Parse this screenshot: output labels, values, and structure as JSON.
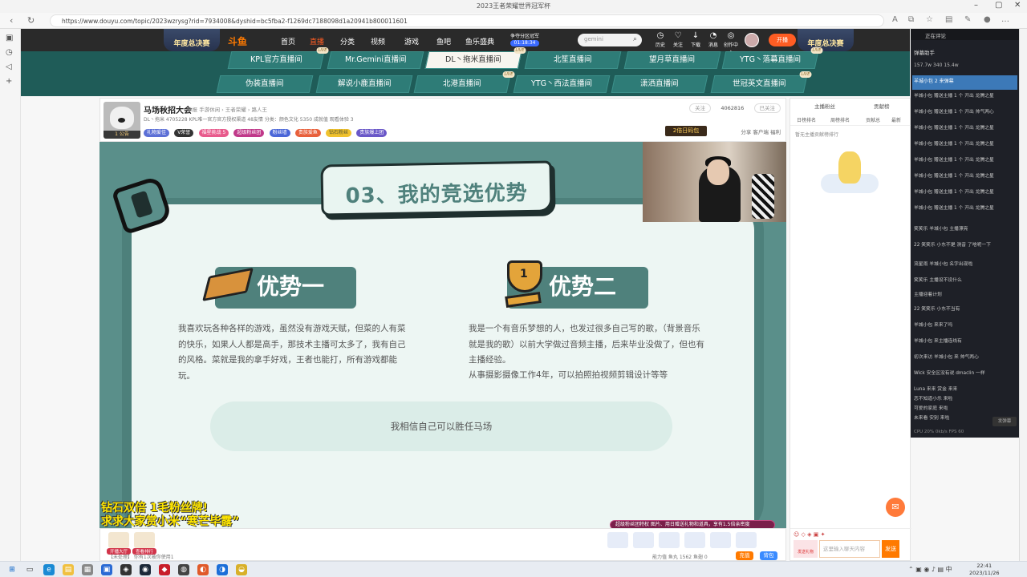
{
  "browser": {
    "tab_title": "2023王者荣耀世界冠军杯",
    "url": "https://www.douyu.com/topic/2023wzrysg?rid=7934008&dyshid=bc5fba2-f1269dc7188098d1a20941b800011601"
  },
  "header": {
    "banner_left": "年度总决赛",
    "banner_right": "年度总决赛",
    "logo": "斗鱼",
    "nav": [
      "首页",
      "直播",
      "分类",
      "视频",
      "游戏",
      "鱼吧",
      "鱼乐盛典"
    ],
    "active_nav": "直播",
    "time_label": "争夺分区冠军",
    "time_value": "01:18:34",
    "search_placeholder": "gemini",
    "icons": [
      {
        "name": "history-icon",
        "label": "历史"
      },
      {
        "name": "follow-icon",
        "label": "关注"
      },
      {
        "name": "download-icon",
        "label": "下载"
      },
      {
        "name": "notice-icon",
        "label": "消息"
      },
      {
        "name": "center-icon",
        "label": "创作中心"
      }
    ],
    "live_button": "开播"
  },
  "rec_rooms": [
    {
      "label": "KPL官方直播间",
      "live": true
    },
    {
      "label": "Mr.Gemini直播间",
      "live": false
    },
    {
      "label": "DL丶拖米直播间",
      "live": true,
      "selected": true
    },
    {
      "label": "北笙直播间",
      "live": false
    },
    {
      "label": "望月草直播间",
      "live": false
    },
    {
      "label": "YTG丶落幕直播间",
      "live": true
    },
    {
      "label": "伪装直播间",
      "live": false
    },
    {
      "label": "解说小鹿直播间",
      "live": false
    },
    {
      "label": "北港直播间",
      "live": true
    },
    {
      "label": "YTG丶西法直播间",
      "live": false
    },
    {
      "label": "潇洒直播间",
      "live": false
    },
    {
      "label": "世冠英文直播间",
      "live": true
    }
  ],
  "streamer": {
    "name": "马场秋招大会",
    "meta": "举报  手游休闲 › 王者荣耀 › 路人王",
    "level": "1 公告",
    "stat_row": "DL丶拖米  4705228   KPL唯一官方官方授权渠道   48友情   分类：颜色文化   5350 成就值   观看体验 3",
    "badges": [
      "礼物爱佳",
      "V荣誉",
      "福星挑战 5",
      "超级粉丝团",
      "粉丝墙",
      "无上榜",
      "贵族爱鱼",
      "钻石粉丝",
      "贵族爆上团"
    ],
    "follow_count": "4062816",
    "follow_btn": "已关注",
    "report_btn": "关注",
    "actions": "分享   客户端   福利",
    "activity_badge": "2倍日码包"
  },
  "slide": {
    "title": "03、我的竞选优势",
    "adv1_title": "优势一",
    "adv2_title": "优势二",
    "adv1_text": "我喜欢玩各种各样的游戏，虽然没有游戏天赋，但菜的人有菜的快乐，如果人人都是高手，那技术主播可太多了，我有自己的风格。菜就是我的拿手好戏，王者也能打，所有游戏都能玩。",
    "adv2_text_1": "我是一个有音乐梦想的人，也发过很多自己写的歌，（背景音乐就是我的歌）以前大学做过音频主播，后来毕业没做了，但也有主播经验。",
    "adv2_text_2": "从事摄影摄像工作4年，可以拍照拍视频剪辑设计等等",
    "belief": "我相信自己可以胜任马场",
    "promo_line1": "钻石双倍 1毛粉丝牌!",
    "promo_line2": "求求大家赏小米“寒芒毕露”",
    "gift_banner": "超级粉丝团特权  图片、用日赠送礼物和道具，享有1.5倍亲密度"
  },
  "playerbar": {
    "gifts": [
      "开播大厅",
      "查看排行"
    ],
    "note": "【未处理】 你有1次被你使用1",
    "mid": "能力值  鱼丸 1562  鱼翅 0",
    "btn1": "充值",
    "btn2": "背包"
  },
  "rank_panel": {
    "tab1": "主播粉丝",
    "tab2": "贡献榜",
    "subtabs": [
      "日榜排名",
      "周榜排名",
      "贡献总",
      "最新"
    ],
    "hint": "暂无主播贡献榜排行",
    "input_placeholder": "这里输入聊天内容",
    "send": "发送",
    "gift_label": "发送礼物"
  },
  "chat_overlay": {
    "top_label": "正在评论",
    "head": "弹幕助手",
    "stats": "157.7w   340   15.4w",
    "highlight": "羊城小包  2  来弹幕",
    "lines": [
      "羊城小包 赠送主播 1 个 开出 龙腾之星",
      "羊城小包 赠送主播 1 个 开出 帅气两心",
      "羊城小包 赠送主播 1 个 开出 龙腾之星",
      "羊城小包 赠送主播 1 个 开出 龙腾之星",
      "羊城小包 赠送主播 1 个 开出 龙腾之星",
      "羊城小包 赠送主播 1 个 开出 龙腾之星",
      "羊城小包 赠送主播 1 个 开出 龙腾之星",
      "羊城小包 赠送主播 1 个 开出 龙腾之星",
      "笑笑乐 羊城小包 主播漂亮",
      "22 笑笑乐 小东不是 测音  了啥呢一下",
      "流星雨 羊城小包 名字出现啦",
      "笑笑乐 主播设不设什么",
      "主播迎着计划",
      "22 笑笑乐 小东不当有",
      "羊城小包 来来了吗",
      "羊城小包 来主播连线有",
      "初次来访 羊城小包 来 帅气两心",
      "Wick 安全区没有说 dmaclin 一样",
      "Luna 来来 赏金  来来",
      "恋不知道小乐  来啦",
      "可爱的家庭 来啦",
      "未来看 安别 来啦"
    ],
    "status": "CPU 20%  0kb/s  FPS 60",
    "side_btn": "发弹幕"
  },
  "taskbar": {
    "time": "22:41",
    "date": "2023/11/26"
  }
}
